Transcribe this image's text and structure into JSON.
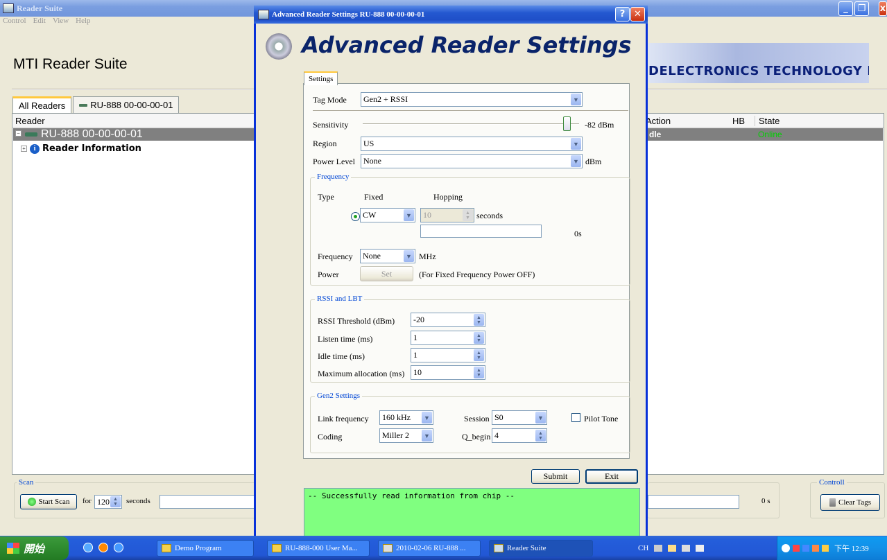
{
  "main_window": {
    "title": "Reader Suite",
    "menu": [
      "Control",
      "Edit",
      "View",
      "Help"
    ],
    "app_name": "MTI Reader Suite",
    "logo_text": "DELECTRONICS TECHNOLOGY INC.",
    "tabs": [
      "All Readers",
      "RU-888 00-00-00-01"
    ],
    "grid_headers": [
      "Reader",
      "Action",
      "HB",
      "State"
    ],
    "row": {
      "reader": "RU-888 00-00-00-01",
      "action": "dle",
      "state": "Online"
    },
    "tree_child": "Reader Information",
    "scan": {
      "group_label": "Scan",
      "start_label": "Start Scan",
      "for_label": "for",
      "seconds_value": "120",
      "seconds_label": "seconds",
      "elapsed": "0 s"
    },
    "controll": {
      "group_label": "Controll",
      "clear_label": "Clear Tags"
    }
  },
  "dialog": {
    "title": "Advanced Reader Settings RU-888 00-00-00-01",
    "heading": "Advanced Reader Settings",
    "tab": "Settings",
    "tag_mode_label": "Tag Mode",
    "tag_mode_value": "Gen2 + RSSI",
    "sensitivity_label": "Sensitivity",
    "sensitivity_value": "-82 dBm",
    "sensitivity_level": 0.98,
    "region_label": "Region",
    "region_value": "US",
    "power_level_label": "Power Level",
    "power_level_value": "None",
    "power_level_unit": "dBm",
    "frequency": {
      "group_label": "Frequency",
      "type_label": "Type",
      "fixed_label": "Fixed",
      "hopping_label": "Hopping",
      "mode_value": "CW",
      "seconds_value": "10",
      "seconds_label": "seconds",
      "elapsed": "0s",
      "frequency_label": "Frequency",
      "frequency_value": "None",
      "frequency_unit": "MHz",
      "power_label": "Power",
      "set_label": "Set",
      "power_note": "(For Fixed Frequency Power OFF)"
    },
    "rssi": {
      "group_label": "RSSI and LBT",
      "threshold_label": "RSSI Threshold (dBm)",
      "threshold_value": "-20",
      "listen_label": "Listen time (ms)",
      "listen_value": "1",
      "idle_label": "Idle time (ms)",
      "idle_value": "1",
      "max_label": "Maximum allocation (ms)",
      "max_value": "10"
    },
    "gen2": {
      "group_label": "Gen2 Settings",
      "link_label": "Link frequency",
      "link_value": "160 kHz",
      "session_label": "Session",
      "session_value": "S0",
      "pilot_label": "Pilot Tone",
      "coding_label": "Coding",
      "coding_value": "Miller 2",
      "qbegin_label": "Q_begin",
      "qbegin_value": "4"
    },
    "submit_label": "Submit",
    "exit_label": "Exit",
    "log_text": "-- Successfully read information from chip --"
  },
  "taskbar": {
    "start_label": "開始",
    "buttons": [
      "Demo Program",
      "RU-888-000 User Ma...",
      "2010-02-06 RU-888 ...",
      "Reader Suite"
    ],
    "tray_lang": "CH",
    "clock": "下午 12:39"
  },
  "colors": {
    "online": "#00d000",
    "log_bg": "#80ff80",
    "title_blue": "#0a246a"
  }
}
